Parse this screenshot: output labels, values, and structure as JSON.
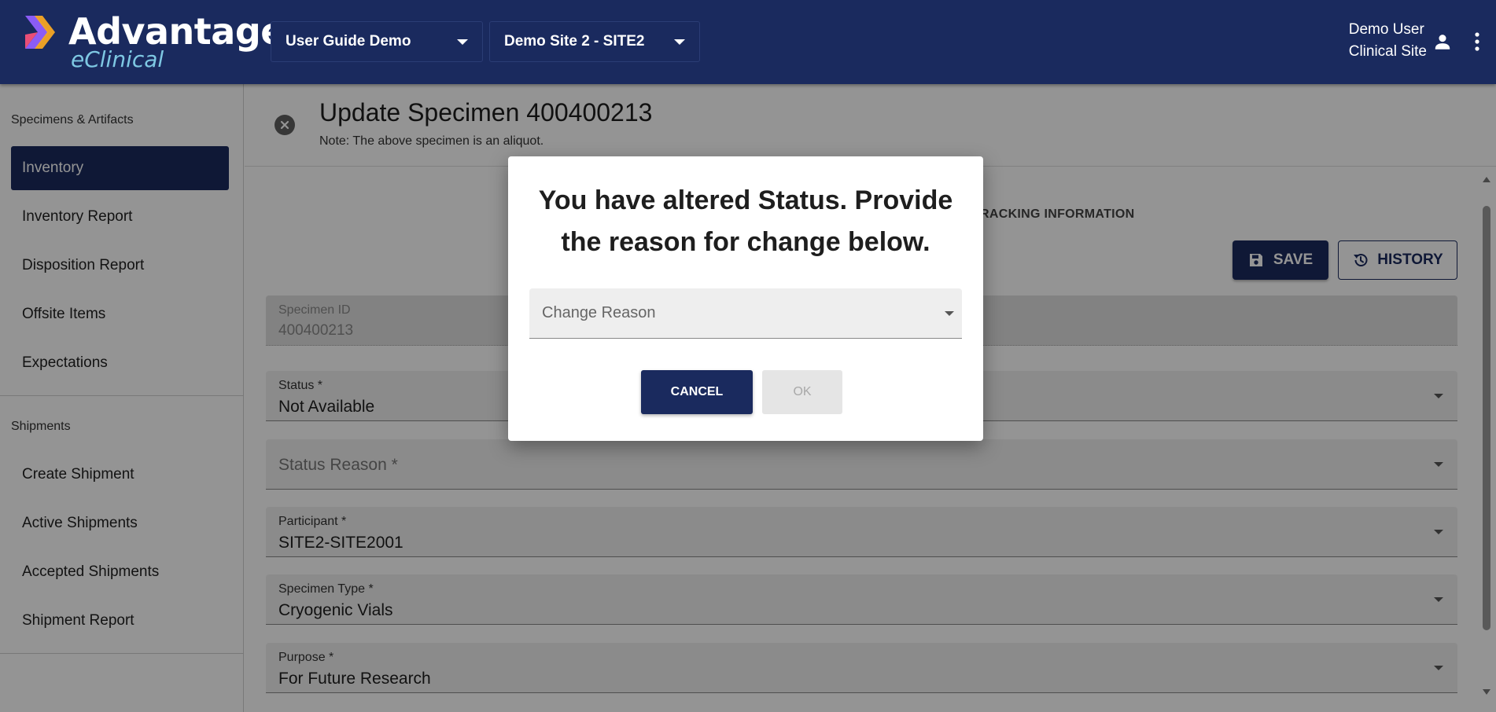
{
  "brand": {
    "name": "Advantage",
    "sub": "eClinical"
  },
  "header": {
    "study_select": "User Guide Demo",
    "site_select": "Demo Site 2 - SITE2",
    "user_name": "Demo User",
    "user_role": "Clinical Site"
  },
  "sidebar": {
    "section1": "Specimens & Artifacts",
    "items1": [
      "Inventory",
      "Inventory Report",
      "Disposition Report",
      "Offsite Items",
      "Expectations"
    ],
    "section2": "Shipments",
    "items2": [
      "Create Shipment",
      "Active Shipments",
      "Accepted Shipments",
      "Shipment Report"
    ]
  },
  "page": {
    "title": "Update Specimen 400400213",
    "note": "Note: The above specimen is an aliquot.",
    "tab_partial": "RACKING INFORMATION",
    "save_label": "SAVE",
    "history_label": "HISTORY"
  },
  "fields": {
    "specimen_id": {
      "label": "Specimen ID",
      "value": "400400213"
    },
    "status": {
      "label": "Status *",
      "value": "Not Available"
    },
    "status_reason": {
      "placeholder": "Status Reason *"
    },
    "participant": {
      "label": "Participant *",
      "value": "SITE2-SITE2001"
    },
    "specimen_type": {
      "label": "Specimen Type *",
      "value": "Cryogenic Vials"
    },
    "purpose": {
      "label": "Purpose *",
      "value": "For Future Research"
    }
  },
  "modal": {
    "title_line1": "You have altered Status. Provide",
    "title_line2": "the reason for change below.",
    "change_reason_placeholder": "Change Reason",
    "cancel_label": "CANCEL",
    "ok_label": "OK"
  },
  "colors": {
    "primary": "#1a2a5e",
    "accent_orange": "#f5a623",
    "accent_purple": "#8b5cf6",
    "brand_sub": "#7ec8e3"
  },
  "icons": [
    "close-circle-icon",
    "save-icon",
    "history-icon",
    "user-icon",
    "kebab-icon",
    "chevron-down-icon"
  ]
}
